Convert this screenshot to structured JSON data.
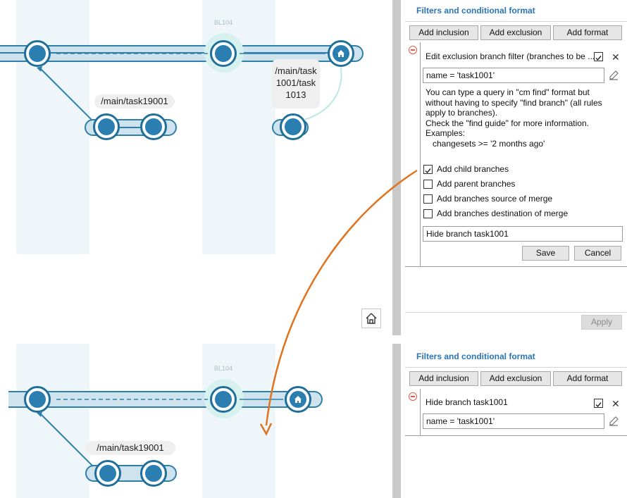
{
  "top_graph": {
    "baseline_label": "BL104",
    "branch_label": "/main/task19001",
    "tooltip_label": "/main/task\n1001/task\n1013"
  },
  "bottom_graph": {
    "baseline_label": "BL104",
    "branch_label": "/main/task19001"
  },
  "top_panel": {
    "title": "Filters and conditional format",
    "buttons": {
      "add_inclusion": "Add inclusion",
      "add_exclusion": "Add exclusion",
      "add_format": "Add format"
    },
    "filter_title": "Edit exclusion branch filter (branches to be ...",
    "query_value": "name = 'task1001'",
    "help_text": "You can type a query in \"cm find\" format but\nwithout having to specify \"find branch\" (all rules\napply to branches).\nCheck the \"find guide\" for more information.\nExamples:\n   changesets >= '2 months ago'",
    "options": [
      {
        "label": "Add child branches",
        "checked": true
      },
      {
        "label": "Add parent branches",
        "checked": false
      },
      {
        "label": "Add branches source of merge",
        "checked": false
      },
      {
        "label": "Add branches destination of merge",
        "checked": false
      }
    ],
    "description_value": "Hide branch task1001",
    "save_label": "Save",
    "cancel_label": "Cancel",
    "apply_label": "Apply"
  },
  "bottom_panel": {
    "title": "Filters and conditional format",
    "buttons": {
      "add_inclusion": "Add inclusion",
      "add_exclusion": "Add exclusion",
      "add_format": "Add format"
    },
    "filter_title": "Hide branch task1001",
    "query_value": "name = 'task1001'"
  },
  "colors": {
    "accent": "#2a74b8",
    "branch": "#2f7fa8",
    "arrow": "#e0731e",
    "remove": "#e05a4a"
  },
  "icons": [
    "home-icon",
    "remove-filter-icon",
    "checkbox-icon",
    "close-icon",
    "edit-icon"
  ]
}
